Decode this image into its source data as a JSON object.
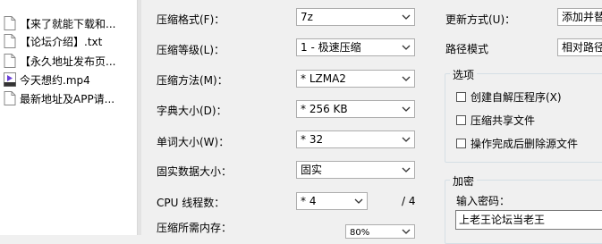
{
  "files": [
    {
      "name": "来了就能下载和...",
      "kind": "text",
      "display": "【来了就能下载和..."
    },
    {
      "name": "论坛介绍.txt",
      "display": "【论坛介绍】.txt",
      "kind": "text"
    },
    {
      "name": "永久地址发布页",
      "display": "【永久地址发布页...",
      "kind": "text"
    },
    {
      "name": "今天想约.mp4",
      "display": "今天想约.mp4",
      "kind": "video"
    },
    {
      "name": "最新地址及APP请",
      "display": "最新地址及APP请...",
      "kind": "text"
    }
  ],
  "icons": {
    "text_file": "text-file-icon",
    "video_file": "mp4-file-icon",
    "dropdown": "chevron-down-icon"
  },
  "form": {
    "format_label": "压缩格式(F)：",
    "format_value": "7z",
    "level_label": "压缩等级(L)：",
    "level_value": "1 - 极速压缩",
    "method_label": "压缩方法(M)：",
    "method_value": "* LZMA2",
    "dict_label": "字典大小(D)：",
    "dict_value": "* 256 KB",
    "word_label": "单词大小(W)：",
    "word_value": "* 32",
    "solid_label": "固实数据大小：",
    "solid_value": "固实",
    "threads_label": "CPU 线程数：",
    "threads_value": "* 4",
    "threads_max": "/ 4",
    "memory_label": "压缩所需内存：",
    "memory_value": "80%"
  },
  "right": {
    "update_label": "更新方式(U)：",
    "update_value": "添加并替",
    "path_label": "路径模式",
    "path_value": "相对路径"
  },
  "options": {
    "title": "选项",
    "sfx": "创建自解压程序(X)",
    "shared": "压缩共享文件",
    "delete": "操作完成后删除源文件"
  },
  "encryption": {
    "title": "加密",
    "password_label": "输入密码：",
    "password_value": "上老王论坛当老王"
  }
}
